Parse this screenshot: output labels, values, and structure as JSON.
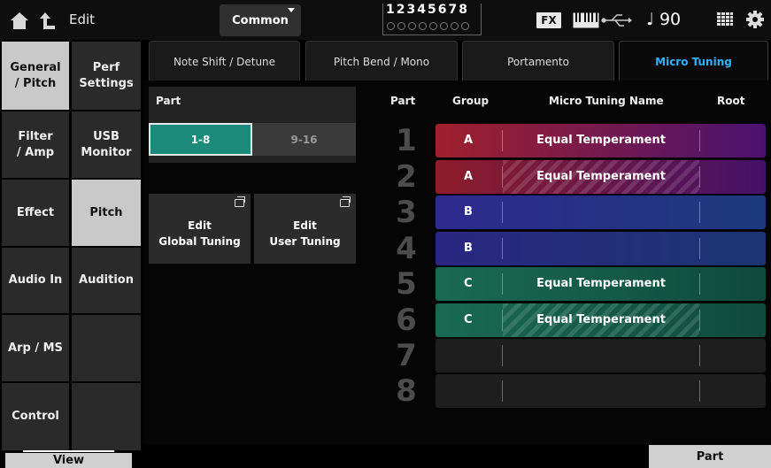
{
  "topbar": {
    "title": "Edit",
    "common_label": "Common",
    "parts_numbers": "12345678",
    "fx_label": "FX",
    "tempo": "90"
  },
  "nav": {
    "col1": [
      {
        "label": "General\n/ Pitch",
        "active": true
      },
      {
        "label": "Filter\n/ Amp",
        "active": false
      },
      {
        "label": "Effect",
        "active": false
      },
      {
        "label": "Audio In",
        "active": false
      },
      {
        "label": "Arp / MS",
        "active": false
      },
      {
        "label": "Control",
        "active": false
      }
    ],
    "col2": [
      {
        "label": "Perf\nSettings",
        "active": false
      },
      {
        "label": "USB\nMonitor",
        "active": false
      },
      {
        "label": "Pitch",
        "active": true
      },
      {
        "label": "Audition",
        "active": false
      },
      {
        "label": "",
        "active": false
      },
      {
        "label": "",
        "active": false
      }
    ]
  },
  "tabs": [
    {
      "label": "Note Shift / Detune",
      "active": false
    },
    {
      "label": "Pitch Bend / Mono",
      "active": false
    },
    {
      "label": "Portamento",
      "active": false
    },
    {
      "label": "Micro Tuning",
      "active": true
    }
  ],
  "part_selector": {
    "title": "Part",
    "options": [
      {
        "label": "1-8",
        "active": true
      },
      {
        "label": "9-16",
        "active": false
      }
    ]
  },
  "edit_buttons": {
    "global": "Edit\nGlobal Tuning",
    "user": "Edit\nUser Tuning"
  },
  "table": {
    "headers": {
      "part": "Part",
      "group": "Group",
      "name": "Micro Tuning Name",
      "root": "Root"
    },
    "rows": [
      {
        "part": "1",
        "group": "A",
        "name": "Equal Temperament",
        "root": "",
        "color": "#a0202c",
        "color2": "#4a1270",
        "hatched": false
      },
      {
        "part": "2",
        "group": "A",
        "name": "Equal Temperament",
        "root": "",
        "color": "#8e1d2a",
        "color2": "#441168",
        "hatched": true
      },
      {
        "part": "3",
        "group": "B",
        "name": "",
        "root": "",
        "color": "#2e2a8e",
        "color2": "#1d3a7e",
        "hatched": false
      },
      {
        "part": "4",
        "group": "B",
        "name": "",
        "root": "",
        "color": "#2a2782",
        "color2": "#1b3572",
        "hatched": false
      },
      {
        "part": "5",
        "group": "C",
        "name": "Equal Temperament",
        "root": "",
        "color": "#1a6a52",
        "color2": "#0f4a3c",
        "hatched": false
      },
      {
        "part": "6",
        "group": "C",
        "name": "Equal Temperament",
        "root": "",
        "color": "#1a6a52",
        "color2": "#0f4a3c",
        "hatched": true
      },
      {
        "part": "7",
        "group": "",
        "name": "",
        "root": "",
        "color": "#1e1e1e",
        "color2": "#1e1e1e",
        "hatched": false
      },
      {
        "part": "8",
        "group": "",
        "name": "",
        "root": "",
        "color": "#1e1e1e",
        "color2": "#1e1e1e",
        "hatched": false
      }
    ]
  },
  "bottom": {
    "view_label": "View",
    "part_label": "Part"
  },
  "colors": {
    "accent_blue": "#2fb3ff",
    "selected_teal": "#1c8a7a"
  }
}
